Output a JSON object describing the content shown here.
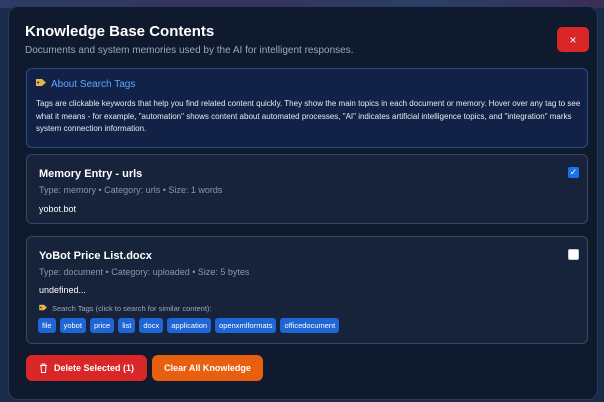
{
  "modal": {
    "title": "Knowledge Base Contents",
    "subtitle": "Documents and system memories used by the AI for intelligent responses.",
    "close_label": "×"
  },
  "info": {
    "icon": "tag-icon",
    "title": "About Search Tags",
    "body": "Tags are clickable keywords that help you find related content quickly. They show the main topics in each document or memory. Hover over any tag to see what it means - for example, \"automation\" shows content about automated processes, \"AI\" indicates artificial intelligence topics, and \"integration\" marks system connection information."
  },
  "entries": [
    {
      "title": "Memory Entry - urls",
      "meta": "Type: memory • Category: urls • Size: 1 words",
      "content": "yobot.bot",
      "selected": true
    },
    {
      "title": "YoBot Price List.docx",
      "meta": "Type: document • Category: uploaded • Size: 5 bytes",
      "content": "undefined...",
      "selected": false,
      "search_tags_label": "Search Tags (click to search for similar content):",
      "tags": [
        "file",
        "yobot",
        "price",
        "list",
        "docx",
        "application",
        "openxmlformats",
        "officedocument"
      ]
    }
  ],
  "actions": {
    "delete_selected": "Delete Selected (1)",
    "clear_all": "Clear All Knowledge"
  },
  "colors": {
    "accent_blue": "#1e66d6",
    "danger_red": "#d92626",
    "warning_orange": "#e8600f",
    "modal_bg": "#0f1a2e"
  }
}
